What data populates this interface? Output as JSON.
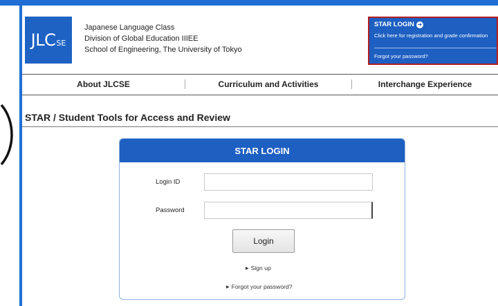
{
  "header": {
    "logo_main": "JLC",
    "logo_sub": "SE",
    "org_lines": [
      "Japanese Language Class",
      "Division of Global Education IIIEE",
      "School of Engineering, The University of Tokyo"
    ]
  },
  "star_box": {
    "title": "STAR LOGIN",
    "subtitle": "Click here for registration and grade confirmation",
    "forgot": "Forgot your password?"
  },
  "nav": {
    "items": [
      "About JLCSE",
      "Curriculum and Activities",
      "Interchange Experience"
    ]
  },
  "section": {
    "title": "STAR / Student Tools for Access and Review"
  },
  "login_panel": {
    "title": "STAR LOGIN",
    "login_id_label": "Login ID",
    "login_id_value": "",
    "password_label": "Password",
    "password_value": "",
    "login_button": "Login",
    "signup_link": "Sign up",
    "forgot_link": "Forgot your password?"
  },
  "colors": {
    "accent": "#1e5fc2",
    "frame": "#1f6ed4",
    "highlight_border": "#b41e1e"
  }
}
